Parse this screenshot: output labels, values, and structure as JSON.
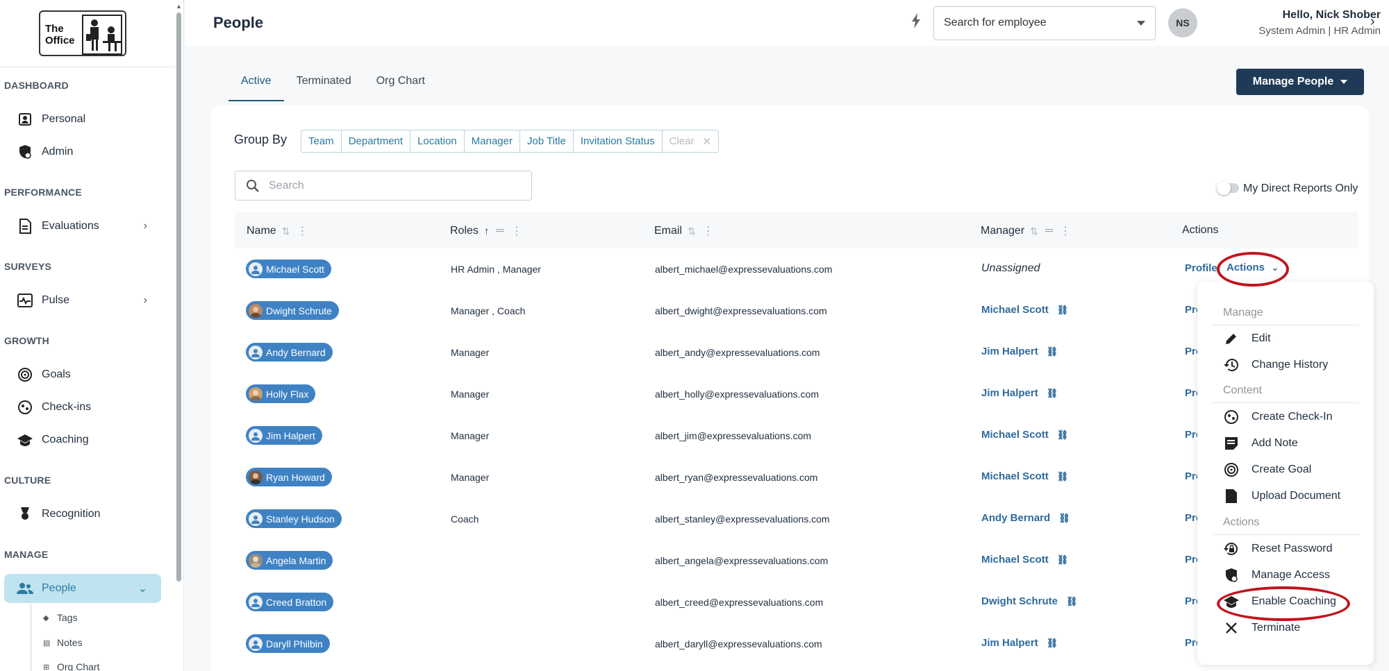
{
  "app": {
    "logo_text_1": "The",
    "logo_text_2": "Office"
  },
  "sidebar": {
    "sections": {
      "dashboard": "DASHBOARD",
      "performance": "PERFORMANCE",
      "surveys": "SURVEYS",
      "growth": "GROWTH",
      "culture": "CULTURE",
      "manage": "MANAGE"
    },
    "items": {
      "personal": "Personal",
      "admin": "Admin",
      "evaluations": "Evaluations",
      "pulse": "Pulse",
      "goals": "Goals",
      "checkins": "Check-ins",
      "coaching": "Coaching",
      "recognition": "Recognition",
      "people": "People"
    },
    "subitems": {
      "tags": "Tags",
      "notes": "Notes",
      "org_chart": "Org Chart"
    }
  },
  "header": {
    "title": "People",
    "employee_search_placeholder": "Search for employee",
    "avatar_initials": "NS",
    "greeting": "Hello, Nick Shober",
    "roles": "System Admin |  HR Admin"
  },
  "tabs": {
    "active": "Active",
    "terminated": "Terminated",
    "org_chart": "Org Chart"
  },
  "manage_people_label": "Manage People",
  "group_by": {
    "label": "Group By",
    "chips": [
      "Team",
      "Department",
      "Location",
      "Manager",
      "Job Title",
      "Invitation Status"
    ],
    "clear": "Clear"
  },
  "search_placeholder": "Search",
  "direct_reports_label": "My Direct Reports Only",
  "table": {
    "columns": {
      "name": "Name",
      "roles": "Roles",
      "email": "Email",
      "manager": "Manager",
      "actions": "Actions"
    },
    "profile_label": "Profile",
    "profile_truncated": "Pro",
    "actions_label": "Actions",
    "rows": [
      {
        "name": "Michael Scott",
        "roles": "HR Admin , Manager",
        "email": "albert_michael@expressevaluations.com",
        "manager": "Unassigned"
      },
      {
        "name": "Dwight Schrute",
        "roles": "Manager , Coach",
        "email": "albert_dwight@expressevaluations.com",
        "manager": "Michael Scott"
      },
      {
        "name": "Andy Bernard",
        "roles": "Manager",
        "email": "albert_andy@expressevaluations.com",
        "manager": "Jim Halpert"
      },
      {
        "name": "Holly Flax",
        "roles": "Manager",
        "email": "albert_holly@expressevaluations.com",
        "manager": "Jim Halpert"
      },
      {
        "name": "Jim Halpert",
        "roles": "Manager",
        "email": "albert_jim@expressevaluations.com",
        "manager": "Michael Scott"
      },
      {
        "name": "Ryan Howard",
        "roles": "Manager",
        "email": "albert_ryan@expressevaluations.com",
        "manager": "Michael Scott"
      },
      {
        "name": "Stanley Hudson",
        "roles": "Coach",
        "email": "albert_stanley@expressevaluations.com",
        "manager": "Andy Bernard"
      },
      {
        "name": "Angela Martin",
        "roles": "",
        "email": "albert_angela@expressevaluations.com",
        "manager": "Michael Scott"
      },
      {
        "name": "Creed Bratton",
        "roles": "",
        "email": "albert_creed@expressevaluations.com",
        "manager": "Dwight Schrute"
      },
      {
        "name": "Daryll Philbin",
        "roles": "",
        "email": "albert_daryll@expressevaluations.com",
        "manager": "Jim Halpert"
      }
    ]
  },
  "actions_menu": {
    "manage_header": "Manage",
    "edit": "Edit",
    "change_history": "Change History",
    "content_header": "Content",
    "create_checkin": "Create Check-In",
    "add_note": "Add Note",
    "create_goal": "Create Goal",
    "upload_document": "Upload Document",
    "actions_header": "Actions",
    "reset_password": "Reset Password",
    "manage_access": "Manage Access",
    "enable_coaching": "Enable Coaching",
    "terminate": "Terminate"
  },
  "colors": {
    "accent": "#2a7aa3",
    "primary_button": "#1e3a56",
    "pill": "#3e82c4",
    "highlight_ring": "#c0151c"
  }
}
